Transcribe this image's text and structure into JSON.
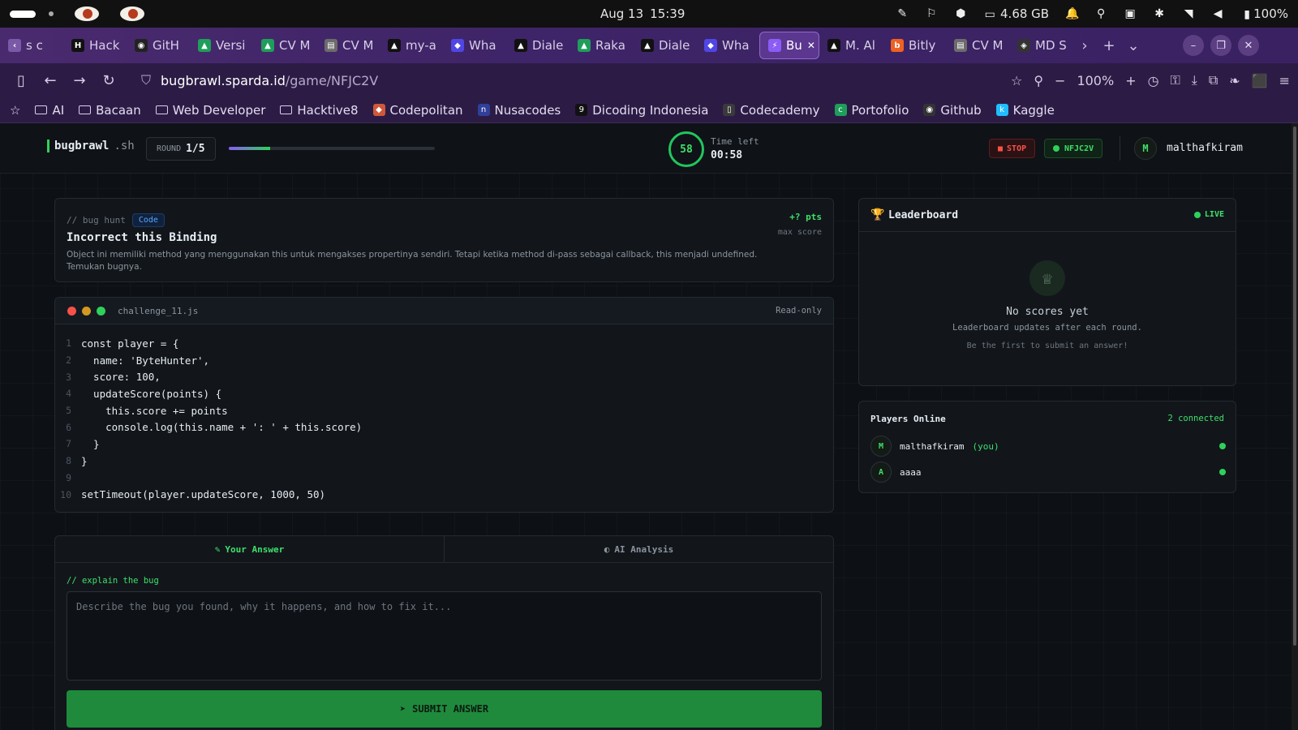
{
  "os": {
    "date": "Aug 13",
    "time": "15:39",
    "memory": "4.68 GB",
    "battery": "100%"
  },
  "tabs": [
    {
      "label": "s c",
      "color": "#7a5aa8",
      "glyph": "‹"
    },
    {
      "label": "Hack",
      "color": "#111111",
      "glyph": "H"
    },
    {
      "label": "GitH",
      "color": "#222222",
      "glyph": "◉"
    },
    {
      "label": "Versi",
      "color": "#1e9e5a",
      "glyph": "▲"
    },
    {
      "label": "CV M",
      "color": "#1e9e5a",
      "glyph": "▲"
    },
    {
      "label": "CV M",
      "color": "#6b6b6b",
      "glyph": "▤"
    },
    {
      "label": "my-a",
      "color": "#111111",
      "glyph": "▲"
    },
    {
      "label": "Wha",
      "color": "#4f46e5",
      "glyph": "◆"
    },
    {
      "label": "Diale",
      "color": "#111111",
      "glyph": "▲"
    },
    {
      "label": "Raka",
      "color": "#1e9e5a",
      "glyph": "▲"
    },
    {
      "label": "Diale",
      "color": "#111111",
      "glyph": "▲"
    },
    {
      "label": "Wha",
      "color": "#4f46e5",
      "glyph": "◆"
    },
    {
      "label": "Bu",
      "color": "#8b5cf6",
      "glyph": "⚡",
      "active": true
    },
    {
      "label": "M. Al",
      "color": "#111111",
      "glyph": "▲"
    },
    {
      "label": "Bitly",
      "color": "#ee6123",
      "glyph": "b"
    },
    {
      "label": "CV M",
      "color": "#6b6b6b",
      "glyph": "▤"
    },
    {
      "label": "MD S",
      "color": "#333333",
      "glyph": "◈"
    }
  ],
  "address": {
    "url_host": "bugbrawl.sparda.id",
    "url_path": "/game/NFJC2V",
    "zoom": "100%"
  },
  "bookmarks": [
    {
      "label": "AI",
      "type": "folder"
    },
    {
      "label": "Bacaan",
      "type": "folder"
    },
    {
      "label": "Web Developer",
      "type": "folder"
    },
    {
      "label": "Hacktive8",
      "type": "folder"
    },
    {
      "label": "Codepolitan",
      "type": "site",
      "color": "#d0583a",
      "glyph": "◆"
    },
    {
      "label": "Nusacodes",
      "type": "site",
      "color": "#2f3f9a",
      "glyph": "n"
    },
    {
      "label": "Dicoding Indonesia",
      "type": "site",
      "color": "#111111",
      "glyph": "9"
    },
    {
      "label": "Codecademy",
      "type": "site",
      "color": "#3a3a3a",
      "glyph": "▯"
    },
    {
      "label": "Portofolio",
      "type": "site",
      "color": "#1e9e5a",
      "glyph": "c"
    },
    {
      "label": "Github",
      "type": "site",
      "color": "#333333",
      "glyph": "◉"
    },
    {
      "label": "Kaggle",
      "type": "site",
      "color": "#20beff",
      "glyph": "k"
    }
  ],
  "header": {
    "logo": "bugbrawl",
    "logo_ext": ".sh",
    "round_label": "ROUND",
    "round_value": "1/5",
    "round_progress": 0.2,
    "timer_value": "58",
    "time_left_label": "Time left",
    "time_left_value": "00:58",
    "stop_label": "STOP",
    "room_code": "NFJC2V",
    "avatar_initial": "M",
    "username": "malthafkiram"
  },
  "task": {
    "crumb": "// bug hunt",
    "tag": "Code",
    "title": "Incorrect this Binding",
    "description": "Object ini memiliki method yang menggunakan this untuk mengakses propertinya sendiri. Tetapi ketika method di-pass sebagai callback, this menjadi undefined. Temukan bugnya.",
    "points": "+? pts",
    "points_label": "max score"
  },
  "editor": {
    "filename": "challenge_11.js",
    "mode": "Read-only",
    "lines": [
      "const player = {",
      "  name: 'ByteHunter',",
      "  score: 100,",
      "  updateScore(points) {",
      "    this.score += points",
      "    console.log(this.name + ': ' + this.score)",
      "  }",
      "}",
      "",
      "setTimeout(player.updateScore, 1000, 50)"
    ]
  },
  "answer": {
    "tab_answer": "Your Answer",
    "tab_ai": "AI Analysis",
    "hint": "// explain the bug",
    "placeholder": "Describe the bug you found, why it happens, and how to fix it...",
    "submit_label": "SUBMIT ANSWER"
  },
  "leaderboard": {
    "title": "Leaderboard",
    "live_label": "LIVE",
    "empty_title": "No scores yet",
    "empty_sub": "Leaderboard updates after each round.",
    "empty_hint": "Be the first to submit an answer!"
  },
  "players": {
    "title": "Players Online",
    "count_label": "2 connected",
    "list": [
      {
        "initial": "M",
        "name": "malthafkiram",
        "you_label": "(you)"
      },
      {
        "initial": "A",
        "name": "aaaa",
        "you_label": ""
      }
    ]
  },
  "colors": {
    "accent_green": "#2fd15a",
    "danger": "#f85149",
    "browser_purple": "#3e2468"
  }
}
